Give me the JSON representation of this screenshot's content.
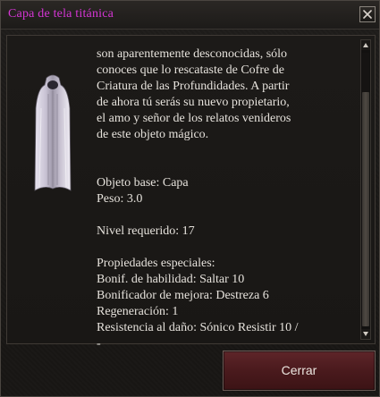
{
  "window": {
    "title": "Capa de tela titánica",
    "close_icon": "close-icon"
  },
  "item": {
    "icon": "cloak-icon",
    "description_lines": [
      "son aparentemente desconocidas, sólo",
      "conoces que lo rescataste de Cofre de",
      "Criatura de las Profundidades. A partir",
      "de ahora tú serás su nuevo propietario,",
      "el amo y señor de los relatos venideros",
      "de este objeto mágico."
    ],
    "base_item": "Objeto base: Capa",
    "weight": "Peso: 3.0",
    "required_level": "Nivel requerido: 17",
    "properties_heading": "Propiedades especiales:",
    "properties": [
      "Bonif. de habilidad: Saltar 10",
      "Bonificador de mejora: Destreza 6",
      "Regeneración: 1",
      "Resistencia al daño: Sónico Resistir 10 /",
      "-"
    ]
  },
  "scrollbar": {
    "position_fraction": 1.0
  },
  "footer": {
    "close_button_label": "Cerrar"
  },
  "colors": {
    "title": "#d535d5",
    "text": "#e6e2dc",
    "button_bg": "#4a1a1d"
  }
}
